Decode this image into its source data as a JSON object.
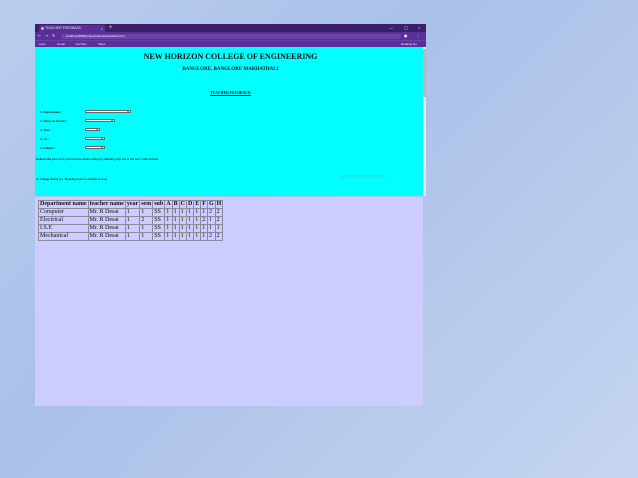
{
  "browser": {
    "tab_title": "TEACHER FEEDBACK",
    "tab_close": "×",
    "new_tab": "+",
    "window_controls": [
      "—",
      "▢",
      "×"
    ],
    "url": "localhost:8080/project/teacherfeedback.html",
    "bookmarks": [
      "Apps",
      "Gmail",
      "YouTube",
      "Maps"
    ],
    "reading_list": "Reading list"
  },
  "form_page": {
    "college_name": "NEW HORIZON COLLEGE OF ENGINEERING",
    "address": "BANGLORE, BANGLORE MARHATHALI",
    "heading": "TEACHER FEEDBACK",
    "questions": [
      {
        "label": "1. Department :"
      },
      {
        "label": "2. Name of teacher :"
      },
      {
        "label": "3. Year :"
      },
      {
        "label": "4. sec :"
      },
      {
        "label": "5. Subject :"
      }
    ],
    "instruction": "Indicate the perceived performance of the college by selecting only one of the four radio buttons",
    "criterion_a": "A. College timing (i.e. Working hours is suitable or not)"
  },
  "results": {
    "headers": [
      "Department name",
      "teacher name",
      "year",
      "sem",
      "sub",
      "A",
      "B",
      "C",
      "D",
      "E",
      "F",
      "G",
      "H"
    ],
    "rows": [
      [
        "Computer",
        "Mr. R Desai",
        "1",
        "1",
        "SS",
        "1",
        "1",
        "1",
        "1",
        "1",
        "1",
        "2",
        "2"
      ],
      [
        "Electrical",
        "Mr. R Desai",
        "1",
        "2",
        "SS",
        "1",
        "1",
        "1",
        "1",
        "1",
        "2",
        "1",
        "2"
      ],
      [
        "I.S.E",
        "Mr. R Desai",
        "1",
        "1",
        "SS",
        "1",
        "1",
        "1",
        "1",
        "1",
        "1",
        "1",
        "1"
      ],
      [
        "Mechanical",
        "Mr. R Desai",
        "1",
        "1",
        "SS",
        "1",
        "1",
        "1",
        "1",
        "1",
        "1",
        "2",
        "2"
      ]
    ]
  },
  "colors": {
    "form_background": "#00ffff",
    "results_background": "#ccccff",
    "browser_chrome": "#5b2f9a"
  }
}
